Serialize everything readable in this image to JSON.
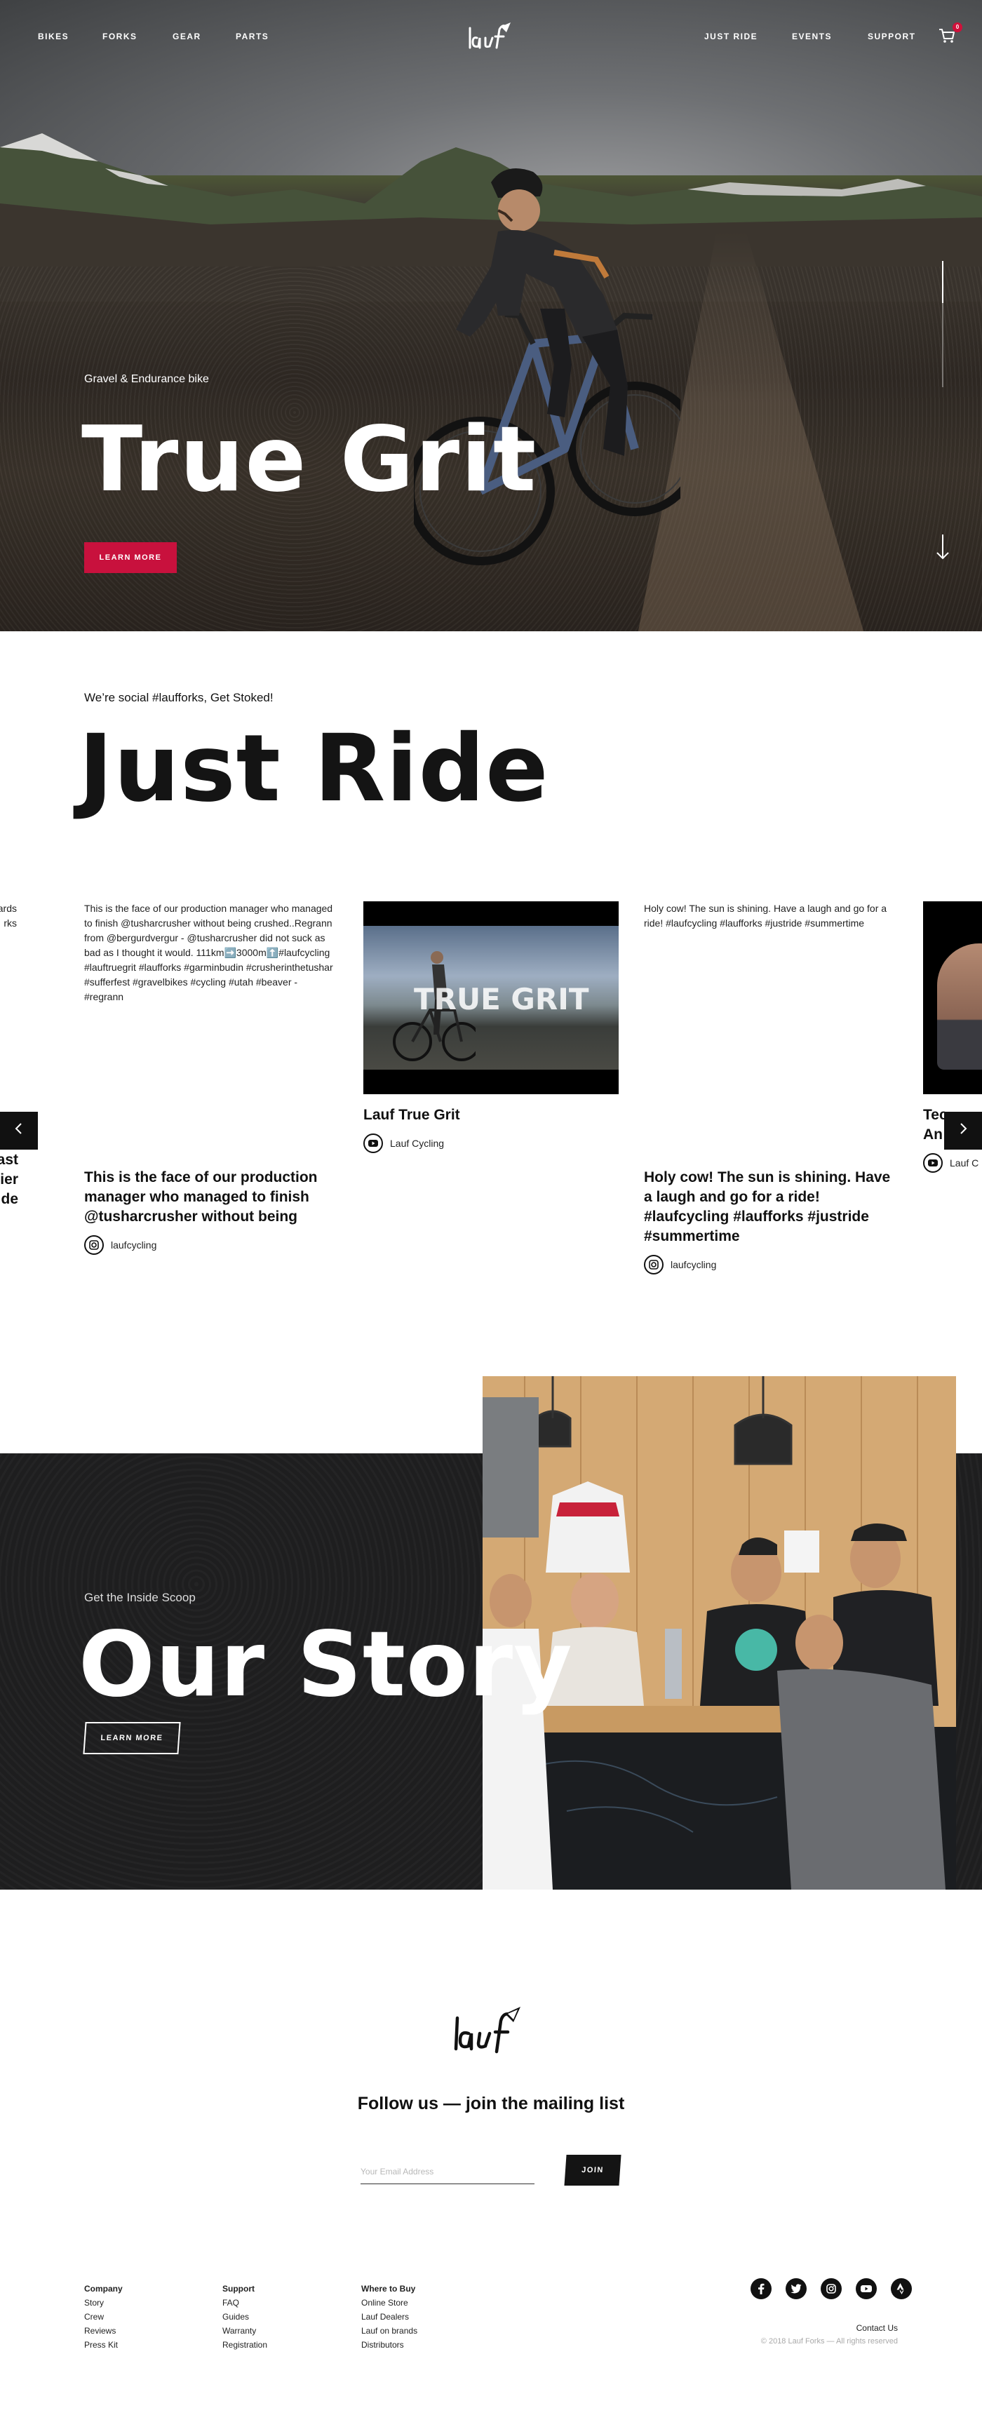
{
  "nav": {
    "left": [
      "BIKES",
      "FORKS",
      "GEAR",
      "PARTS"
    ],
    "right": [
      "JUST RIDE",
      "EVENTS",
      "SUPPORT"
    ],
    "cart_count": "0",
    "logo": "lauf"
  },
  "hero": {
    "kicker": "Gravel & Endurance bike",
    "title": "True Grit",
    "cta": "LEARN MORE"
  },
  "social": {
    "kicker": "We’re social #laufforks, Get Stoked!",
    "title": "Just Ride",
    "cards": [
      {
        "caption": "wards\nrks",
        "headline": "e last\ncier\nstride",
        "source": ""
      },
      {
        "caption": "This is the face of our production manager who managed to finish @tusharcrusher without being crushed..Regrann from @bergurdvergur - @tusharcrusher did not suck as bad as I thought it would. 111km➡️3000m⬆️#laufcycling #lauftruegrit #laufforks #garminbudin #crusherinthetushar #sufferfest #gravelbikes #cycling #utah #beaver - #regrann",
        "headline": "This is the face of our production manager who managed to finish @tusharcrusher without being",
        "source": "laufcycling",
        "source_icon": "instagram-icon"
      },
      {
        "video_title": "TRUE GRIT",
        "headline": "Lauf True Grit",
        "source": "Lauf Cycling",
        "source_icon": "youtube-icon"
      },
      {
        "caption": "Holy cow! The sun is shining. Have a laugh and go for a ride!  #laufcycling #laufforks #justride #summertime",
        "headline": "Holy cow! The sun is shining. Have a laugh and go for a ride! #laufcycling #laufforks #justride #summertime",
        "source": "laufcycling",
        "source_icon": "instagram-icon"
      },
      {
        "headline": "Tec\nAn",
        "source": "Lauf C",
        "source_icon": "youtube-icon"
      }
    ]
  },
  "story": {
    "kicker": "Get the Inside Scoop",
    "title": "Our Story",
    "cta": "LEARN MORE"
  },
  "newsletter": {
    "title": "Follow us — join the mailing list",
    "placeholder": "Your Email Address",
    "button": "JOIN"
  },
  "footer": {
    "columns": [
      {
        "heading": "Company",
        "links": [
          "Story",
          "Crew",
          "Reviews",
          "Press Kit"
        ]
      },
      {
        "heading": "Support",
        "links": [
          "FAQ",
          "Guides",
          "Warranty",
          "Registration"
        ]
      },
      {
        "heading": "Where to Buy",
        "links": [
          "Online Store",
          "Lauf Dealers",
          "Lauf on brands",
          "Distributors"
        ]
      }
    ],
    "socials": [
      "facebook-icon",
      "twitter-icon",
      "instagram-icon",
      "youtube-icon",
      "strava-icon"
    ],
    "contact": "Contact Us",
    "copyright": "© 2018 Lauf Forks — All rights reserved"
  },
  "colors": {
    "accent": "#c8113d",
    "dark": "#1f1f20",
    "text": "#141414"
  }
}
